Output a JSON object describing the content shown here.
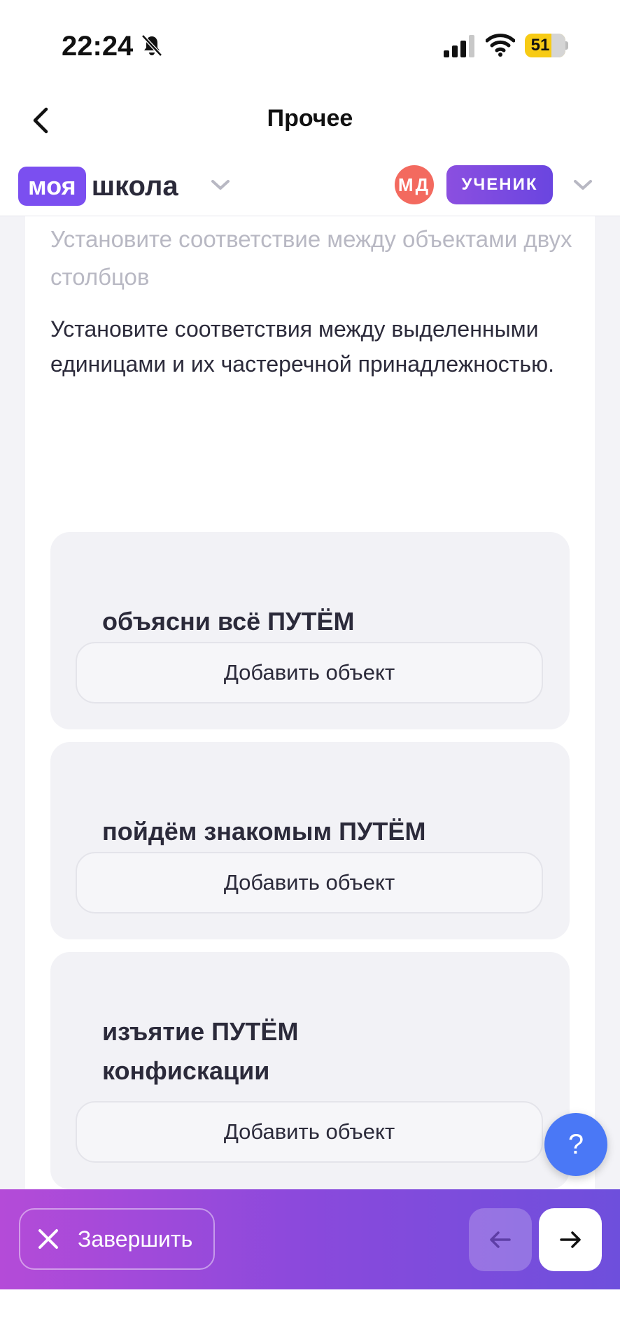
{
  "status_bar": {
    "time": "22:24",
    "battery_level": "51",
    "icons": [
      "bell-slash-icon",
      "signal-icon",
      "wifi-icon",
      "battery-icon"
    ]
  },
  "header": {
    "title": "Прочее",
    "back_icon": "chevron-left-icon"
  },
  "brand": {
    "badge": "моя",
    "word": "школа"
  },
  "user": {
    "initials": "МД",
    "role": "УЧЕНИК"
  },
  "task": {
    "type": "Установите соответствие между объектами двух столбцов",
    "text": "Установите соответствия между выделенными единицами и их частеречной принадлежностью.",
    "items": [
      {
        "label": "объясни всё ПУТЁМ",
        "button": "Добавить объект"
      },
      {
        "label": "пойдём знакомым ПУТЁМ",
        "button": "Добавить объект"
      },
      {
        "label": "изъятие ПУТЁМ конфискации",
        "button": "Добавить объект"
      }
    ]
  },
  "help": {
    "label": "?"
  },
  "bottom": {
    "finish": "Завершить"
  },
  "colors": {
    "brand_purple": "#7b4ff0",
    "avatar_red": "#f36a5f",
    "help_blue": "#4a78f6",
    "bar_gradient_start": "#b44bd8",
    "bar_gradient_end": "#6e4fdc"
  }
}
